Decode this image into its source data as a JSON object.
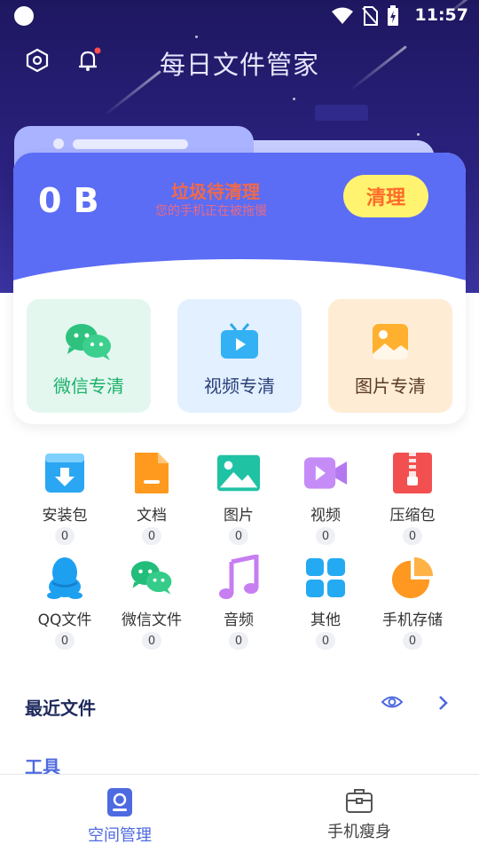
{
  "status_bar": {
    "time": "11:57"
  },
  "header": {
    "title": "每日文件管家"
  },
  "summary": {
    "size": "0 B",
    "junk_title": "垃圾待清理",
    "junk_subtitle": "您的手机正在被拖慢",
    "clean_button": "清理"
  },
  "quick_tiles": [
    {
      "label": "微信专清",
      "icon": "wechat-icon",
      "bg": "#e3f7ef",
      "color": "#1bb16a"
    },
    {
      "label": "视频专清",
      "icon": "tv-icon",
      "bg": "#e2f0ff",
      "color": "#2a3f7a"
    },
    {
      "label": "图片专清",
      "icon": "image-icon",
      "bg": "#ffecd4",
      "color": "#5a3b2a"
    }
  ],
  "categories": [
    {
      "label": "安装包",
      "count": "0",
      "icon": "download-box-icon"
    },
    {
      "label": "文档",
      "count": "0",
      "icon": "document-icon"
    },
    {
      "label": "图片",
      "count": "0",
      "icon": "picture-icon"
    },
    {
      "label": "视频",
      "count": "0",
      "icon": "video-icon"
    },
    {
      "label": "压缩包",
      "count": "0",
      "icon": "zip-icon"
    },
    {
      "label": "QQ文件",
      "count": "0",
      "icon": "penguin-icon"
    },
    {
      "label": "微信文件",
      "count": "0",
      "icon": "wechat-icon"
    },
    {
      "label": "音频",
      "count": "0",
      "icon": "music-note-icon"
    },
    {
      "label": "其他",
      "count": "0",
      "icon": "grid-icon"
    },
    {
      "label": "手机存储",
      "count": "0",
      "icon": "pie-icon"
    }
  ],
  "sections": {
    "recent": "最近文件",
    "tools": "工具"
  },
  "bottom_nav": [
    {
      "label": "空间管理",
      "active": true
    },
    {
      "label": "手机瘦身",
      "active": false
    }
  ],
  "colors": {
    "accent": "#4e6ae0",
    "header_bg": "#231b6e",
    "card_blue": "#5b6cf5"
  }
}
